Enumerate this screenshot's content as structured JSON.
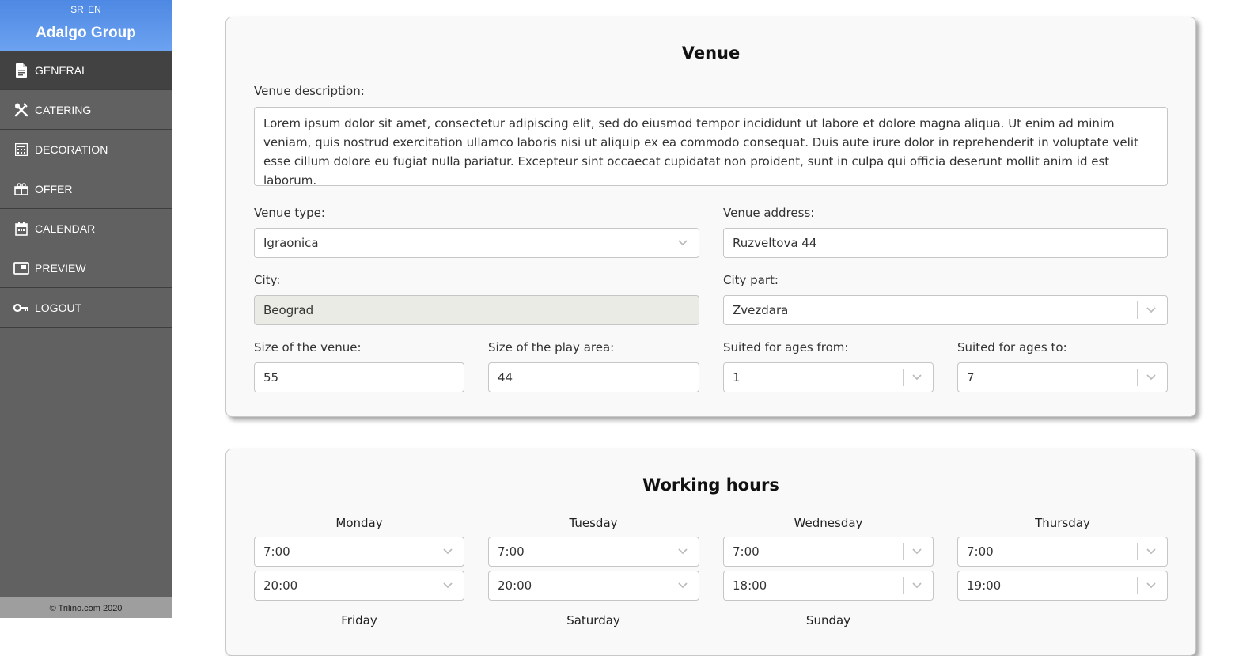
{
  "sidebar": {
    "languages": [
      "SR",
      "EN"
    ],
    "brand": "Adalgo Group",
    "items": [
      {
        "label": "GENERAL",
        "icon": "document-icon"
      },
      {
        "label": "CATERING",
        "icon": "utensils-icon"
      },
      {
        "label": "DECORATION",
        "icon": "decoration-icon"
      },
      {
        "label": "OFFER",
        "icon": "gift-icon"
      },
      {
        "label": "CALENDAR",
        "icon": "calendar-icon"
      },
      {
        "label": "PREVIEW",
        "icon": "preview-icon"
      },
      {
        "label": "LOGOUT",
        "icon": "key-icon"
      }
    ],
    "active_item": "GENERAL",
    "footer": "© Trilino.com 2020"
  },
  "venue": {
    "title": "Venue",
    "description_label": "Venue description:",
    "description": "Lorem ipsum dolor sit amet, consectetur adipiscing elit, sed do eiusmod tempor incididunt ut labore et dolore magna aliqua. Ut enim ad minim veniam, quis nostrud exercitation ullamco laboris nisi ut aliquip ex ea commodo consequat. Duis aute irure dolor in reprehenderit in voluptate velit esse cillum dolore eu fugiat nulla pariatur. Excepteur sint occaecat cupidatat non proident, sunt in culpa qui officia deserunt mollit anim id est laborum.",
    "type_label": "Venue type:",
    "type_value": "Igraonica",
    "address_label": "Venue address:",
    "address_value": "Ruzveltova 44",
    "city_label": "City:",
    "city_value": "Beograd",
    "city_part_label": "City part:",
    "city_part_value": "Zvezdara",
    "size_label": "Size of the venue:",
    "size_value": "55",
    "play_area_label": "Size of the play area:",
    "play_area_value": "44",
    "ages_from_label": "Suited for ages from:",
    "ages_from_value": "1",
    "ages_to_label": "Suited for ages to:",
    "ages_to_value": "7"
  },
  "hours": {
    "title": "Working hours",
    "days": [
      {
        "name": "Monday",
        "open": "7:00",
        "close": "20:00"
      },
      {
        "name": "Tuesday",
        "open": "7:00",
        "close": "20:00"
      },
      {
        "name": "Wednesday",
        "open": "7:00",
        "close": "18:00"
      },
      {
        "name": "Thursday",
        "open": "7:00",
        "close": "19:00"
      }
    ],
    "next_days": [
      "Friday",
      "Saturday",
      "Sunday"
    ]
  },
  "colors": {
    "sidebar": "#616161",
    "sidebar_active": "#424242",
    "header_gradient_top": "#4d88e3",
    "footer": "#9e9e9e"
  }
}
